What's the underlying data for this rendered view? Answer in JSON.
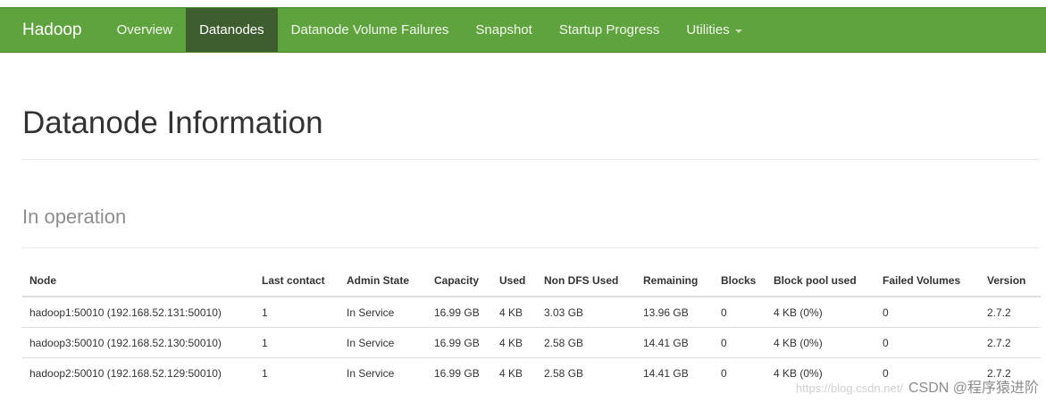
{
  "navbar": {
    "brand": "Hadoop",
    "items": [
      {
        "label": "Overview",
        "active": false
      },
      {
        "label": "Datanodes",
        "active": true
      },
      {
        "label": "Datanode Volume Failures",
        "active": false
      },
      {
        "label": "Snapshot",
        "active": false
      },
      {
        "label": "Startup Progress",
        "active": false
      },
      {
        "label": "Utilities",
        "active": false,
        "dropdown": true
      }
    ],
    "colors": {
      "bar": "#5fa33e",
      "active": "#3e5e2f"
    }
  },
  "page_title": "Datanode Information",
  "section_title": "In operation",
  "table": {
    "headers": [
      "Node",
      "Last contact",
      "Admin State",
      "Capacity",
      "Used",
      "Non DFS Used",
      "Remaining",
      "Blocks",
      "Block pool used",
      "Failed Volumes",
      "Version"
    ],
    "rows": [
      [
        "hadoop1:50010 (192.168.52.131:50010)",
        "1",
        "In Service",
        "16.99 GB",
        "4 KB",
        "3.03 GB",
        "13.96 GB",
        "0",
        "4 KB (0%)",
        "0",
        "2.7.2"
      ],
      [
        "hadoop3:50010 (192.168.52.130:50010)",
        "1",
        "In Service",
        "16.99 GB",
        "4 KB",
        "2.58 GB",
        "14.41 GB",
        "0",
        "4 KB (0%)",
        "0",
        "2.7.2"
      ],
      [
        "hadoop2:50010 (192.168.52.129:50010)",
        "1",
        "In Service",
        "16.99 GB",
        "4 KB",
        "2.58 GB",
        "14.41 GB",
        "0",
        "4 KB (0%)",
        "0",
        "2.7.2"
      ]
    ]
  },
  "watermark": {
    "url": "https://blog.csdn.net/",
    "author": "CSDN @程序猿进阶"
  }
}
